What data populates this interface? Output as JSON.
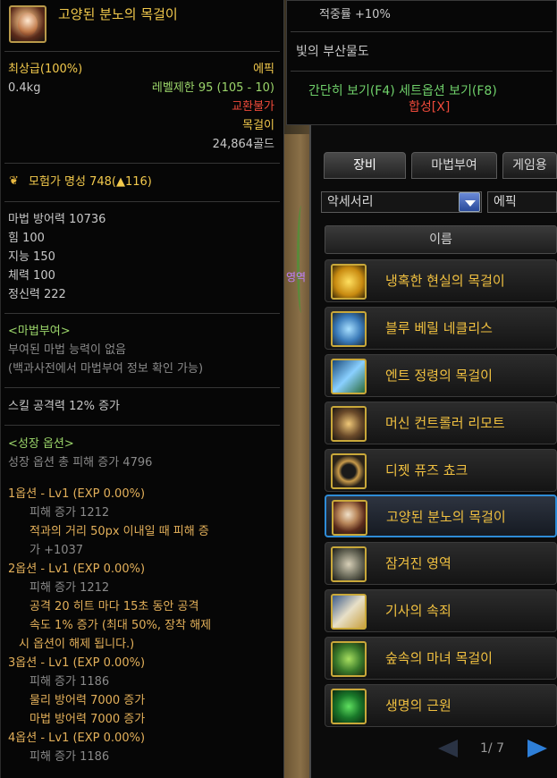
{
  "tooltip": {
    "name": "고양된 분노의 목걸이",
    "grade": "최상급(100%)",
    "rarity": "에픽",
    "weight": "0.4kg",
    "level_req": "레벨제한 95 (105 - 10)",
    "trade": "교환불가",
    "slot": "목걸이",
    "price": "24,864골드",
    "fame": "모험가 명성 748(▲116)",
    "stats": [
      "마법 방어력 10736",
      "힘 100",
      "지능 150",
      "체력 100",
      "정신력 222"
    ],
    "enchant_header": "<마법부여>",
    "enchant_none": "부여된 마법 능력이 없음",
    "enchant_hint": "(백과사전에서 마법부여 정보 확인 가능)",
    "skill": "스킬 공격력 12% 증가",
    "growth_header": "<성장 옵션>",
    "growth_total": "성장 옵션 총 피해 증가 4796",
    "opt1_title": "1옵션 - Lv1 (EXP 0.00%)",
    "opt1_l1": "피해 증가 1212",
    "opt1_l2": "적과의 거리 50px 이내일 때 피해 증",
    "opt1_l3": "가 +1037",
    "opt2_title": "2옵션 - Lv1 (EXP 0.00%)",
    "opt2_l1": "피해 증가 1212",
    "opt2_l2": "공격 20 히트 마다 15초 동안 공격",
    "opt2_l3": "속도 1% 증가 (최대 50%, 장착 해제",
    "opt2_l4": "시 옵션이 해제 됩니다.)",
    "opt3_title": "3옵션 - Lv1 (EXP 0.00%)",
    "opt3_l1": "피해 증가 1186",
    "opt3_l2": "물리 방어력 7000 증가",
    "opt3_l3": "마법 방어력 7000 증가",
    "opt4_title": "4옵션 - Lv1 (EXP 0.00%)",
    "opt4_l1": "피해 증가 1186"
  },
  "tooltip2": {
    "accuracy": "적중률 +10%",
    "set_name": "빛의 부산물도",
    "links": "간단히 보기(F4) 세트옵션 보기(F8)",
    "merge": "합성[X]"
  },
  "scene": {
    "tag": "영역"
  },
  "inventory": {
    "tabs": [
      "장비",
      "마법부여",
      "게임용"
    ],
    "filter_category": "악세서리",
    "filter_rarity": "에픽",
    "column_header": "이름",
    "items": [
      {
        "label": "냉혹한 현실의 목걸이"
      },
      {
        "label": "블루 베릴 네클리스"
      },
      {
        "label": "엔트 정령의 목걸이"
      },
      {
        "label": "머신 컨트롤러 리모트"
      },
      {
        "label": "디젯 퓨즈 쵸크"
      },
      {
        "label": "고양된 분노의 목걸이"
      },
      {
        "label": "잠겨진 영역"
      },
      {
        "label": "기사의 속죄"
      },
      {
        "label": "숲속의 마녀 목걸이"
      },
      {
        "label": "생명의 근원"
      }
    ],
    "page": "1/ 7"
  },
  "colors": {
    "accent_blue": "#2e8bd6",
    "gold": "#e3b05a",
    "epic": "#f2c94c",
    "red": "#ee4a3a",
    "green": "#9bd56a"
  }
}
